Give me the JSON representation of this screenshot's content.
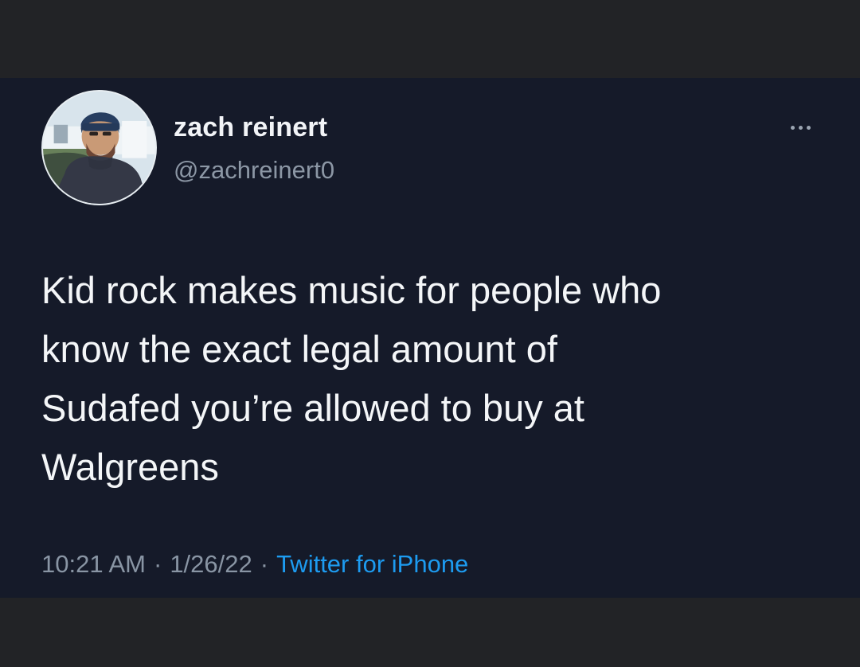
{
  "tweet": {
    "user": {
      "display_name": "zach reinert",
      "handle": "@zachreinert0",
      "avatar": "profile-photo"
    },
    "more_icon": "more-horizontal-icon",
    "text_lines": [
      "Kid rock makes music for people who",
      "know the exact legal amount of",
      "Sudafed you’re allowed to buy at",
      "Walgreens"
    ],
    "time": "10:21 AM",
    "date": "1/26/22",
    "separator": "·",
    "source": "Twitter for iPhone"
  },
  "colors": {
    "outer_background": "#222326",
    "tweet_background": "#151a29",
    "text": "#f4f6f8",
    "secondary_text": "#8995a4",
    "link": "#1d9bf0"
  }
}
